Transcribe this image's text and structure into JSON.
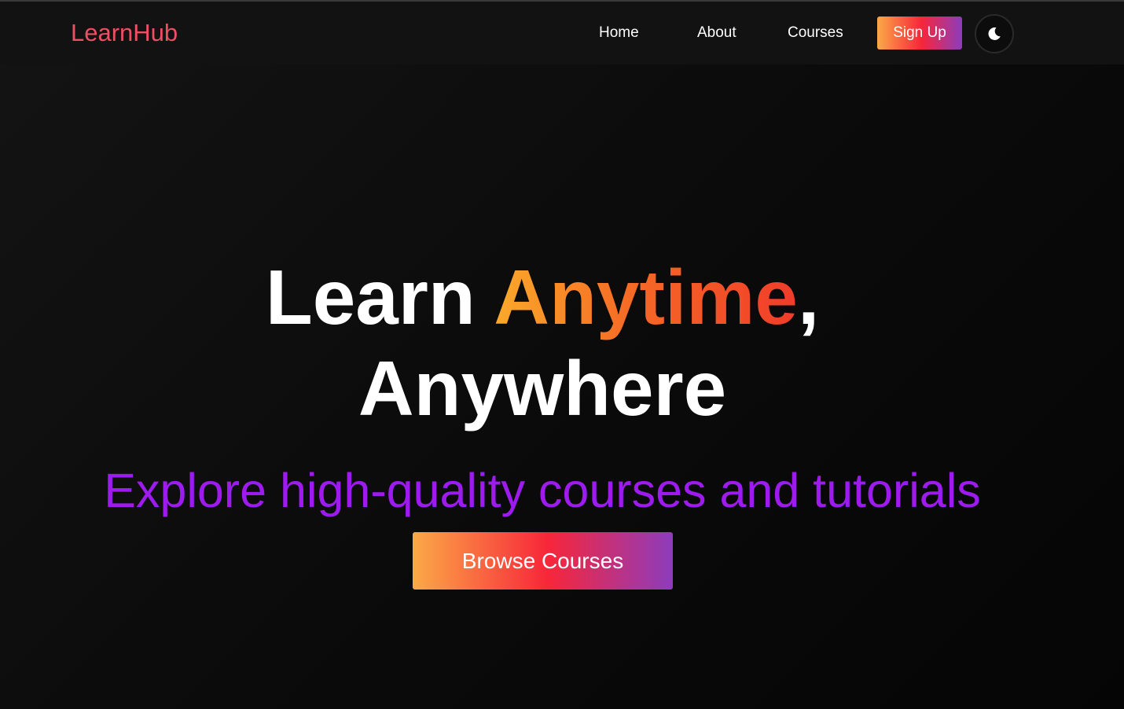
{
  "nav": {
    "logo": "LearnHub",
    "links": [
      {
        "label": "Home"
      },
      {
        "label": "About"
      },
      {
        "label": "Courses"
      }
    ],
    "signup_label": "Sign Up",
    "theme_toggle_icon": "moon-icon"
  },
  "hero": {
    "title_part1": "Learn ",
    "title_highlight": "Anytime",
    "title_part2": ",",
    "title_line2": "Anywhere",
    "subtitle": "Explore high-quality courses and tutorials",
    "cta_label": "Browse Courses"
  },
  "colors": {
    "logo": "#ef4f62",
    "subtitle": "#9d1bef",
    "gradient_start": "#fba947",
    "gradient_mid": "#f7263a",
    "gradient_end": "#8d3cbd"
  }
}
